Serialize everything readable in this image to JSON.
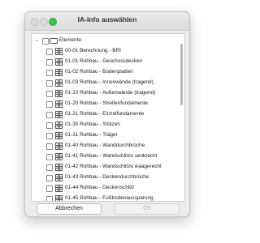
{
  "window": {
    "title": "IA-Info auswählen"
  },
  "tree": {
    "root": {
      "label": "Elemente"
    },
    "items": [
      {
        "label": "00-01 Berechnung - BRI"
      },
      {
        "label": "01-01 Rohbau - Geschossdecken"
      },
      {
        "label": "01-02 Rohbau - Bodenplatten"
      },
      {
        "label": "01-03 Rohbau - Innenwände (tragend)"
      },
      {
        "label": "01-10 Rohbau - Außenwände (tragend)"
      },
      {
        "label": "01-20 Rohbau - Streifenfundamente"
      },
      {
        "label": "01-21 Rohbau - Einzelfundamente"
      },
      {
        "label": "01-30 Rohbau - Stützen"
      },
      {
        "label": "01-31 Rohbau - Träger"
      },
      {
        "label": "01-40 Rohbau - Wanddurchbrüche"
      },
      {
        "label": "01-41 Rohbau - Wandschlitze senkrecht"
      },
      {
        "label": "01-42 Rohbau - Wandschlitze waagerecht"
      },
      {
        "label": "01-43 Rohbau - Deckendurchbrüche"
      },
      {
        "label": "01-44 Rohbau - Deckenschlitz"
      },
      {
        "label": "01-45 Rohbau - Fußbodenaussparung"
      }
    ]
  },
  "buttons": {
    "cancel": "Abbrechen",
    "ok": "OK"
  },
  "icons": {
    "close": "close-icon",
    "minimize": "minimize-icon",
    "zoom": "zoom-icon"
  }
}
